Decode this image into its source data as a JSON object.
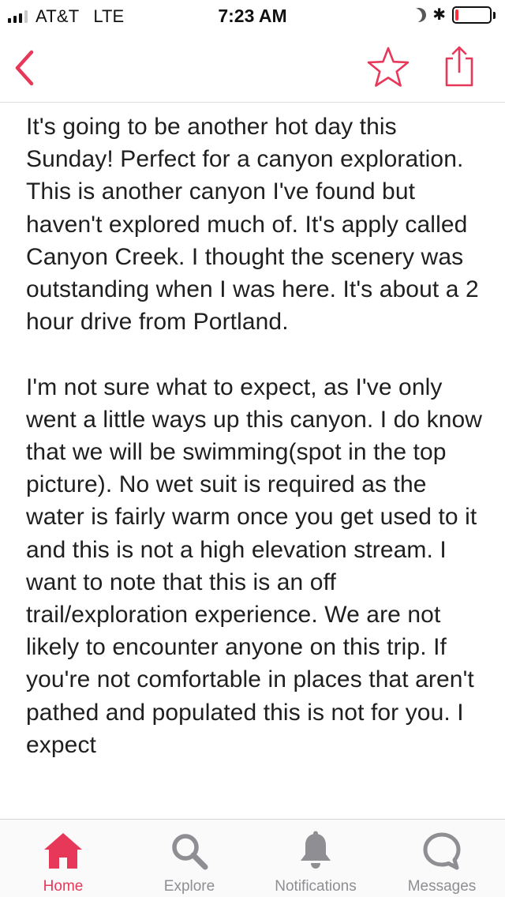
{
  "status_bar": {
    "carrier": "AT&T",
    "network": "LTE",
    "time": "7:23 AM",
    "signal_bars_filled": 3,
    "signal_bars_total": 4,
    "icons": [
      "signal-icon",
      "moon-icon",
      "bluetooth-icon",
      "battery-icon"
    ],
    "battery_level": 0.1
  },
  "nav": {
    "back_icon": "chevron-left-icon",
    "favorite_icon": "star-icon",
    "share_icon": "share-icon",
    "accent_color": "#e8385a"
  },
  "article": {
    "paragraphs": [
      "It's going to be another hot day this Sunday! Perfect for a canyon exploration. This is another canyon I've found but haven't explored much of. It's apply called Canyon Creek. I thought the scenery was outstanding when I was here. It's about a 2 hour drive from Portland.",
      "I'm not sure what to expect, as I've only went a little ways up this canyon. I do know that we will be swimming(spot in the top picture). No wet suit is required as the water is fairly warm once you get used to it and this is not a high elevation stream. I want to note that this is an off trail/exploration experience. We are not likely to encounter anyone on this trip. If you're not comfortable in places that aren't pathed and populated this is not for you. I expect"
    ]
  },
  "tab_bar": {
    "active_color": "#e8385a",
    "inactive_color": "#8e8e93",
    "tabs": [
      {
        "label": "Home",
        "icon": "home-icon",
        "active": true
      },
      {
        "label": "Explore",
        "icon": "search-icon",
        "active": false
      },
      {
        "label": "Notifications",
        "icon": "bell-icon",
        "active": false
      },
      {
        "label": "Messages",
        "icon": "chat-bubble-icon",
        "active": false
      }
    ]
  }
}
